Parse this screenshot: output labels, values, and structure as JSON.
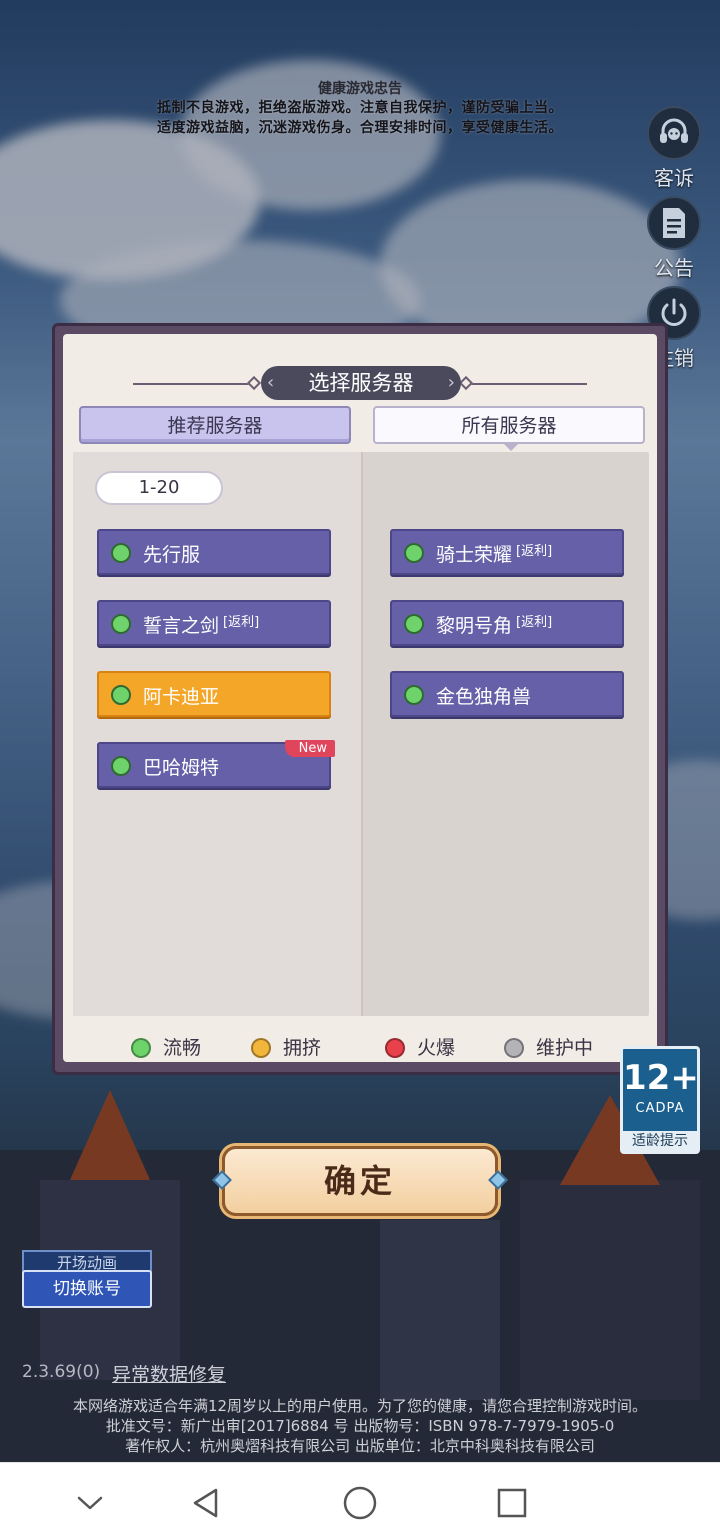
{
  "health_notice": {
    "title": "健康游戏忠告",
    "line1": "抵制不良游戏，拒绝盗版游戏。注意自我保护，谨防受骗上当。",
    "line2": "适度游戏益脑，沉迷游戏伤身。合理安排时间，享受健康生活。"
  },
  "side_buttons": {
    "support": "客诉",
    "announcement": "公告",
    "logout": "注销"
  },
  "dialog": {
    "title": "选择服务器",
    "tabs": {
      "recommended": "推荐服务器",
      "all": "所有服务器"
    },
    "range": "1-20",
    "servers_left": [
      {
        "name": "先行服",
        "tag": "",
        "status": "流畅"
      },
      {
        "name": "誓言之剑",
        "tag": "[返利]",
        "status": "流畅"
      },
      {
        "name": "阿卡迪亚",
        "tag": "",
        "status": "流畅",
        "selected": true
      },
      {
        "name": "巴哈姆特",
        "tag": "",
        "status": "流畅",
        "badge": "New"
      }
    ],
    "servers_right": [
      {
        "name": "骑士荣耀",
        "tag": "[返利]",
        "status": "流畅"
      },
      {
        "name": "黎明号角",
        "tag": "[返利]",
        "status": "流畅"
      },
      {
        "name": "金色独角兽",
        "tag": "",
        "status": "流畅"
      }
    ],
    "legend": [
      {
        "label": "流畅",
        "color": "#6ed36a"
      },
      {
        "label": "拥挤",
        "color": "#f2b73a"
      },
      {
        "label": "火爆",
        "color": "#e8414c"
      },
      {
        "label": "维护中",
        "color": "#b3b3b8"
      }
    ]
  },
  "confirm_label": "确定",
  "age_rating": {
    "age": "12+",
    "org": "CADPA",
    "tip": "适龄提示"
  },
  "opening_anim_label": "开场动画",
  "switch_account_label": "切换账号",
  "version": "2.3.69(0)",
  "repair_label": "异常数据修复",
  "footer": {
    "line1": "本网络游戏适合年满12周岁以上的用户使用。为了您的健康，请您合理控制游戏时间。",
    "line2": "批准文号：新广出审[2017]6884 号  出版物号：ISBN 978-7-7979-1905-0",
    "line3": "著作权人：杭州奥熠科技有限公司  出版单位：北京中科奥科技有限公司"
  },
  "nav": {
    "icons": [
      "chevron-down-icon",
      "back-icon",
      "home-icon",
      "recents-icon"
    ]
  },
  "colors": {
    "server_bg": "#6660a8",
    "selected_bg": "#f4a629",
    "accent": "#4a4a5c"
  }
}
